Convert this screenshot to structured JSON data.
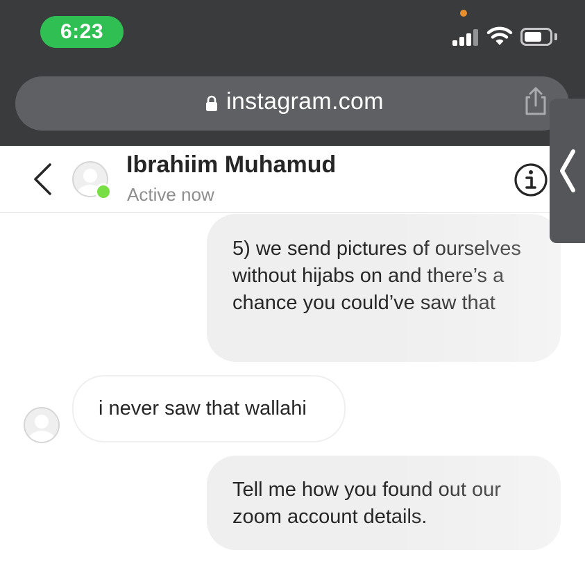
{
  "status_bar": {
    "time": "6:23"
  },
  "browser": {
    "url": "instagram.com"
  },
  "chat": {
    "contact_name": "Ibrahiim Muhamud",
    "contact_status": "Active now"
  },
  "messages": [
    {
      "direction": "outgoing",
      "text": "5) we send pictures of ourselves without hijabs on and there’s a chance you could’ve saw that"
    },
    {
      "direction": "incoming",
      "text": "i never saw that wallahi"
    },
    {
      "direction": "outgoing",
      "text": "Tell me how you found out our zoom account details."
    }
  ],
  "colors": {
    "time_pill": "#2fbf53",
    "online_dot": "#78de45",
    "outgoing_bubble": "#efefef",
    "chrome_bg": "#3a3b3d"
  },
  "icons": [
    "signal-icon",
    "wifi-icon",
    "battery-icon",
    "lock-icon",
    "share-icon",
    "back-chevron-icon",
    "info-icon",
    "sidebar-chevron-icon",
    "avatar-icon"
  ]
}
